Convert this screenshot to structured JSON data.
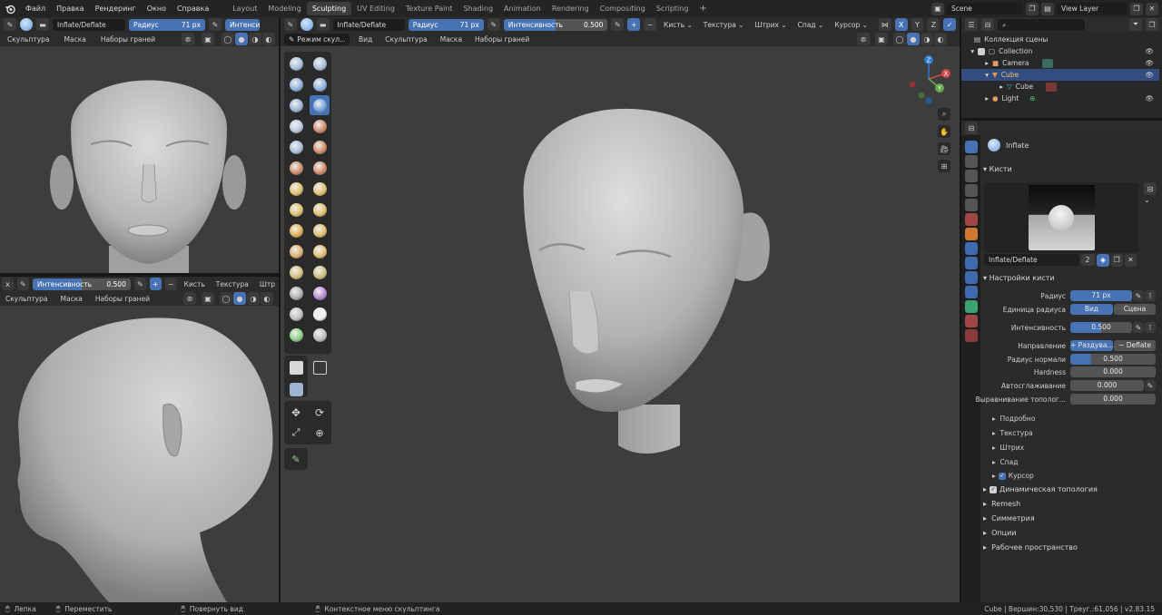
{
  "topbar": {
    "menus": [
      "Файл",
      "Правка",
      "Рендеринг",
      "Окно",
      "Справка"
    ],
    "workspaces": [
      "Layout",
      "Modeling",
      "Sculpting",
      "UV Editing",
      "Texture Paint",
      "Shading",
      "Animation",
      "Rendering",
      "Compositing",
      "Scripting"
    ],
    "active_workspace": "Sculpting",
    "add_tab": "+",
    "scene": "Scene",
    "view_layer": "View Layer"
  },
  "tool_header": {
    "brush_name": "Inflate/Deflate",
    "radius_label": "Радиус",
    "radius_value": "71 px",
    "strength_label": "Интенсивность",
    "strength_value": "0.500",
    "menus": [
      "Кисть",
      "Текстура",
      "Штрих",
      "Спад"
    ],
    "cursor": "Курсор",
    "axes": [
      "X",
      "Y",
      "Z"
    ],
    "left_strength_short": "Интенсив",
    "left_menu_short": "Штри",
    "mode": "Режим скул...",
    "view_menus": [
      "Вид",
      "Скульптура",
      "Маска",
      "Наборы граней"
    ]
  },
  "left_top_header": [
    "Скульптура",
    "Маска",
    "Наборы граней"
  ],
  "left_bottom": {
    "strength_label": "Интенсивность",
    "strength_value": "0.500",
    "menus": [
      "Кисть",
      "Текстура",
      "Штр"
    ],
    "submenus": [
      "Скульптура",
      "Маска",
      "Наборы граней"
    ]
  },
  "outliner": {
    "search_placeholder": "",
    "items": [
      {
        "label": "Коллекция сцены",
        "depth": 0
      },
      {
        "label": "Collection",
        "depth": 1
      },
      {
        "label": "Camera",
        "depth": 2
      },
      {
        "label": "Cube",
        "depth": 2,
        "selected": true
      },
      {
        "label": "Cube",
        "depth": 3
      },
      {
        "label": "Light",
        "depth": 2
      }
    ]
  },
  "properties": {
    "brush_title": "Inflate",
    "brushes_section": "Кисти",
    "brush_field": "Inflate/Deflate",
    "brush_users": "2",
    "settings_section": "Настройки кисти",
    "radius_label": "Радиус",
    "radius_value": "71 px",
    "radius_unit_label": "Единица радиуса",
    "radius_unit_view": "Вид",
    "radius_unit_scene": "Сцена",
    "strength_label": "Интенсивность",
    "strength_value": "0.500",
    "direction_label": "Направление",
    "direction_add": "+ Раздува...",
    "direction_sub": "− Deflate",
    "normal_radius_label": "Радиус нормали",
    "normal_radius_value": "0.500",
    "hardness_label": "Hardness",
    "hardness_value": "0.000",
    "autosmooth_label": "Автосглаживание",
    "autosmooth_value": "0.000",
    "topology_label": "Выравнивание тополог...",
    "topology_value": "0.000",
    "subpanels": [
      "Подробно",
      "Текстура",
      "Штрих",
      "Спад",
      "Курсор"
    ],
    "sections": [
      "Динамическая топология",
      "Remesh",
      "Симметрия",
      "Опции",
      "Рабочее пространство"
    ]
  },
  "status": {
    "left_action": "Лепка",
    "move_action": "Переместить",
    "rotate_action": "Повернуть вид",
    "context_action": "Контекстное меню скульптинга",
    "info": "Cube | Вершин:30,530 | Треуг.:61,056 | v2.83.15"
  },
  "colors": {
    "accent": "#4772b3",
    "viewport": "#3d3d3d",
    "panel": "#2b2b2b",
    "header": "#242424"
  }
}
